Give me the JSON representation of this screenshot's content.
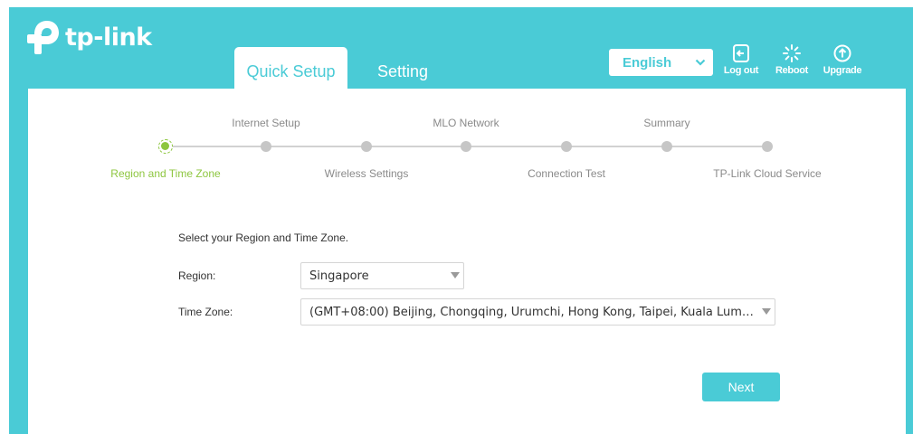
{
  "brand": {
    "logo_text": "tp-link"
  },
  "header": {
    "tabs": [
      {
        "label": "Quick Setup",
        "active": true
      },
      {
        "label": "Setting",
        "active": false
      }
    ],
    "language": "English",
    "tools": [
      {
        "label": "Log out",
        "icon": "logout-icon"
      },
      {
        "label": "Reboot",
        "icon": "reboot-icon"
      },
      {
        "label": "Upgrade",
        "icon": "upgrade-icon"
      }
    ]
  },
  "progress": {
    "steps": [
      {
        "label": "Region and Time Zone",
        "active": true
      },
      {
        "label": "Internet Setup",
        "active": false
      },
      {
        "label": "Wireless Settings",
        "active": false
      },
      {
        "label": "MLO Network",
        "active": false
      },
      {
        "label": "Connection Test",
        "active": false
      },
      {
        "label": "Summary",
        "active": false
      },
      {
        "label": "TP-Link Cloud Service",
        "active": false
      }
    ]
  },
  "form": {
    "intro": "Select your Region and Time Zone.",
    "region_label": "Region:",
    "region_value": "Singapore",
    "timezone_label": "Time Zone:",
    "timezone_value": "(GMT+08:00) Beijing, Chongqing, Urumchi, Hong Kong, Taipei, Kuala Lum…"
  },
  "actions": {
    "next_label": "Next"
  },
  "colors": {
    "accent": "#4acbd6",
    "active_step": "#8dc63f",
    "inactive_step": "#c6c6c6"
  }
}
